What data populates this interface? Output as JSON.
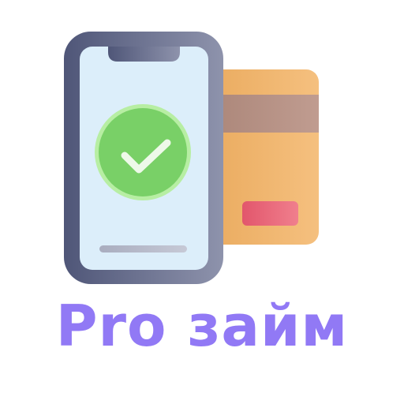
{
  "brand": {
    "name": "Pro займ",
    "text_color": "#9179f5"
  },
  "logo": {
    "icons": [
      "smartphone-icon",
      "bank-card-icon",
      "checkmark-icon"
    ],
    "colors": {
      "phone_frame_dark": "#4f5678",
      "phone_frame_light": "#8e93ac",
      "phone_screen": "#dceefa",
      "check_circle": "#79d067",
      "check_ring": "#b7eea3",
      "card_body": "#f0b46a",
      "card_stripe": "#b78f85",
      "card_chip": "#e8596e"
    }
  }
}
